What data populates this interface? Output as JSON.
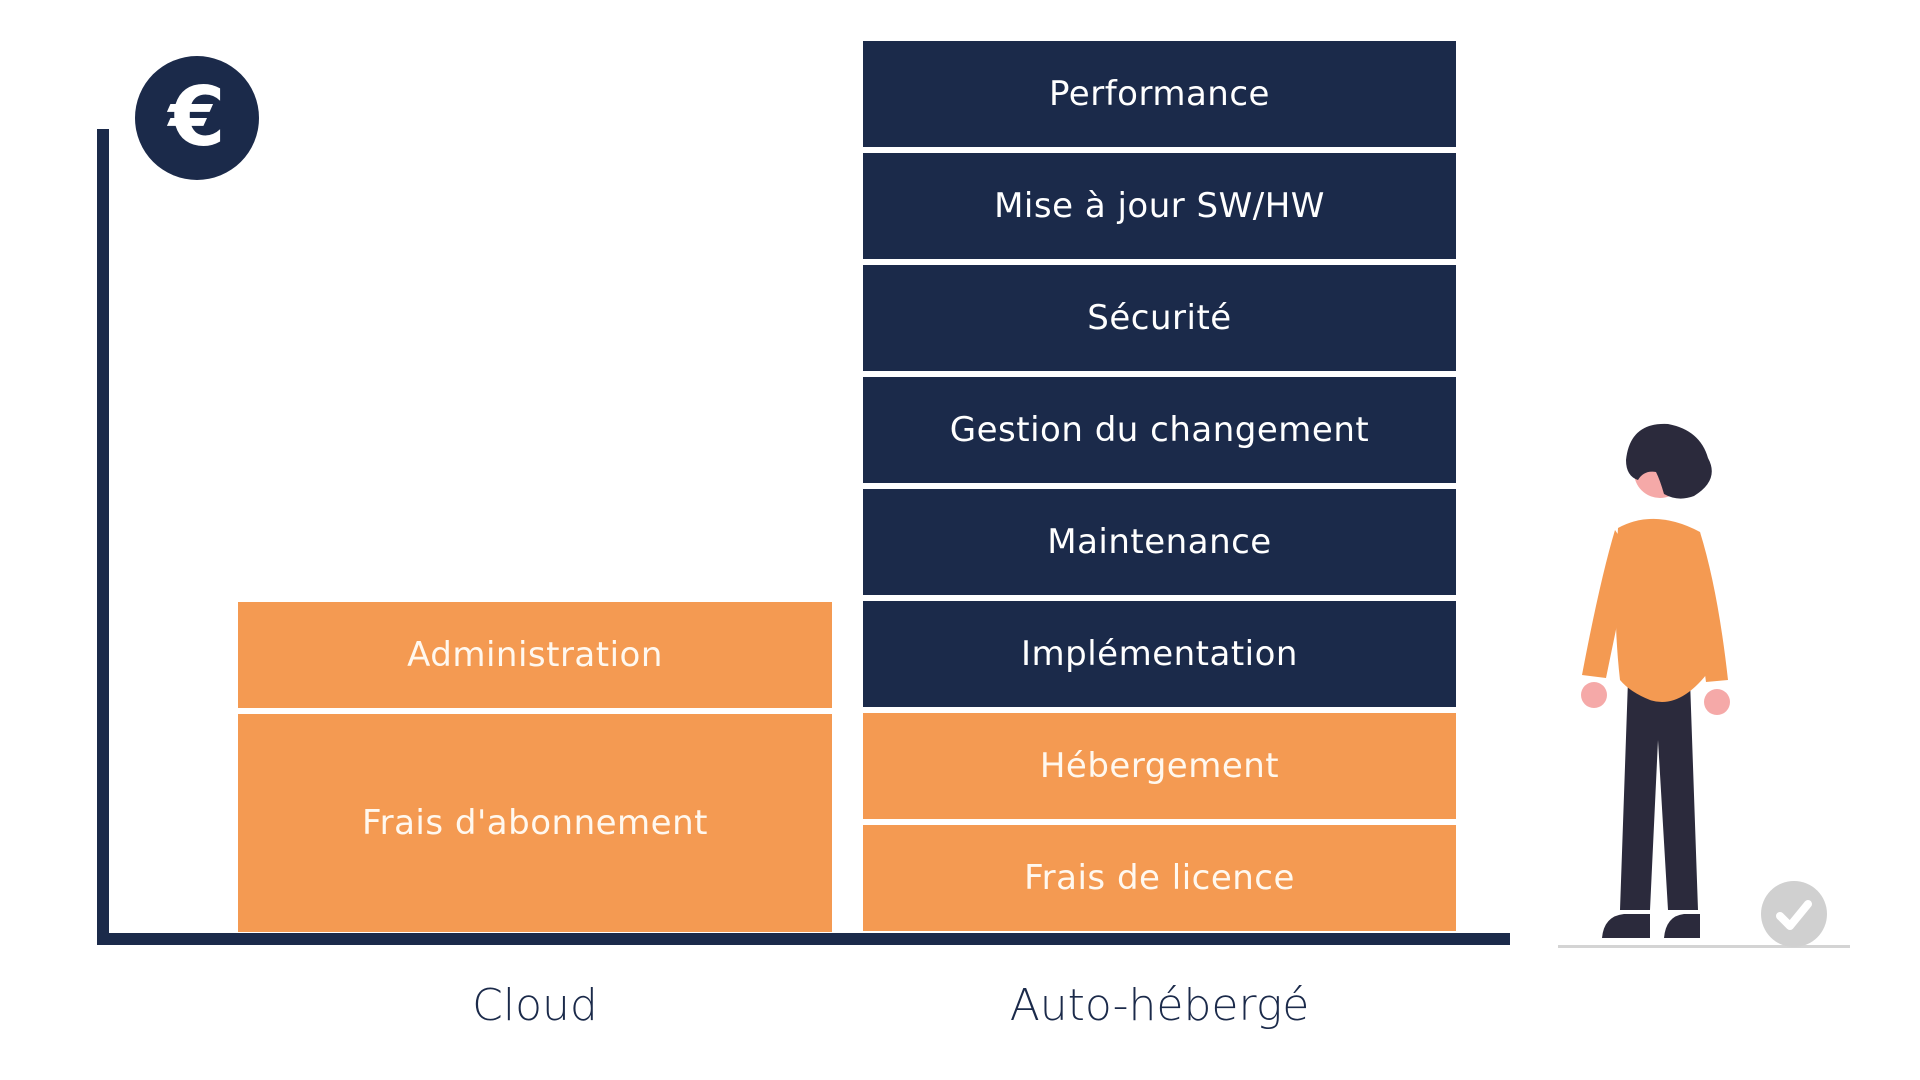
{
  "icons": {
    "currency": "euro-icon",
    "status": "check-circle-icon"
  },
  "euro_symbol": "€",
  "colors": {
    "navy": "#1b2a4a",
    "orange": "#f49a52",
    "skin": "#f5a9a8",
    "check_gray": "#d0d0d0"
  },
  "columns": [
    {
      "label": "Cloud",
      "blocks_top_to_bottom": [
        {
          "label": "Administration",
          "color": "orange"
        },
        {
          "label": "Frais d'abonnement",
          "color": "orange"
        }
      ]
    },
    {
      "label": "Auto-hébergé",
      "blocks_top_to_bottom": [
        {
          "label": "Performance",
          "color": "navy"
        },
        {
          "label": "Mise à jour SW/HW",
          "color": "navy"
        },
        {
          "label": "Sécurité",
          "color": "navy"
        },
        {
          "label": "Gestion du changement",
          "color": "navy"
        },
        {
          "label": "Maintenance",
          "color": "navy"
        },
        {
          "label": "Implémentation",
          "color": "navy"
        },
        {
          "label": "Hébergement",
          "color": "orange"
        },
        {
          "label": "Frais de licence",
          "color": "orange"
        }
      ]
    }
  ]
}
